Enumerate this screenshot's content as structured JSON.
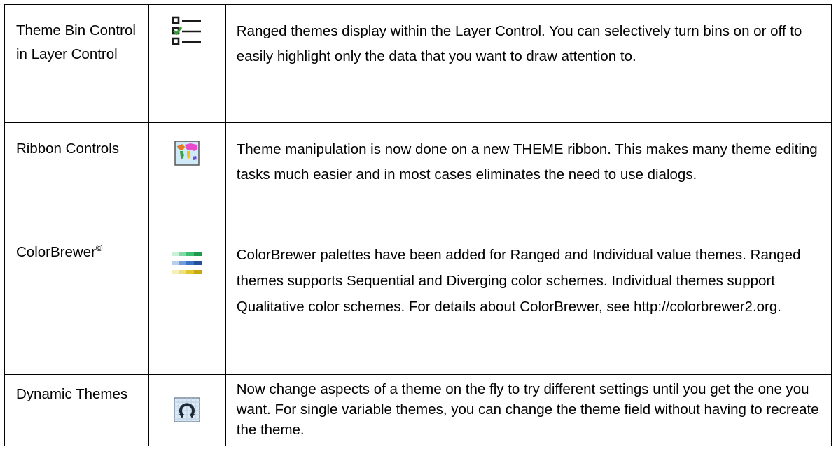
{
  "rows": [
    {
      "feature": "Theme Bin Control in Layer Control",
      "icon": "checklist-icon",
      "description": "Ranged themes display within the Layer Control. You can selectively turn bins on or off to easily highlight only the data that you want to draw attention to."
    },
    {
      "feature": "Ribbon Controls",
      "icon": "world-map-icon",
      "description": "Theme manipulation is now done on a new THEME ribbon. This makes many theme editing tasks much easier and in most cases eliminates the need to use dialogs."
    },
    {
      "feature": "ColorBrewer",
      "feature_sup": "©",
      "icon": "color-palette-icon",
      "description": "ColorBrewer palettes have been added for Ranged and Individual value themes. Ranged themes supports Sequential and Diverging color schemes. Individual themes support Qualitative color schemes. For details about ColorBrewer, see http://colorbrewer2.org."
    },
    {
      "feature": "Dynamic Themes",
      "icon": "refresh-icon",
      "description": "Now change aspects of a theme on the fly to try different settings until you get the one you want. For single variable themes, you can change the theme field without having to recreate the theme."
    }
  ],
  "colors": {
    "border": "#000000",
    "check_green": "#3a9a3a",
    "palette_green": "#2fae5a",
    "palette_blue": "#3b73c4",
    "palette_yellow": "#e0c21a"
  }
}
